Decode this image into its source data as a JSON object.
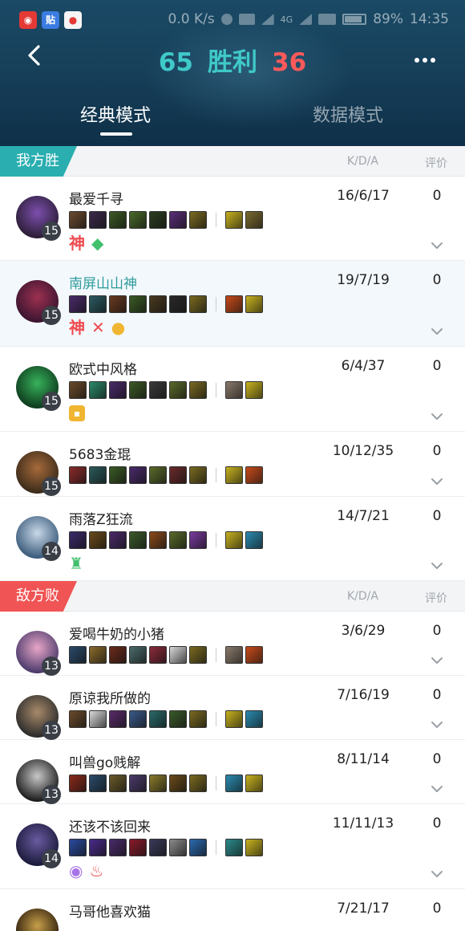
{
  "status_bar": {
    "apps": [
      {
        "name": "netease-music-icon",
        "color": "#e53935"
      },
      {
        "name": "tieba-icon",
        "color": "#3a7ce1"
      },
      {
        "name": "notify-icon",
        "color": "#f5f5f5"
      }
    ],
    "speed": "0.0 K/s",
    "net": "4G",
    "battery": "89%",
    "time": "14:35"
  },
  "header": {
    "back_icon": "back-icon",
    "score_win": "65",
    "result": "胜利",
    "score_lose": "36",
    "more_icon": "more-icon"
  },
  "tabs": [
    {
      "label": "经典模式",
      "active": true
    },
    {
      "label": "数据模式",
      "active": false
    }
  ],
  "columns": {
    "kda": "K/D/A",
    "rating": "评价"
  },
  "teams": [
    {
      "label": "我方胜",
      "color": "#2aaeb0",
      "players": [
        {
          "name": "最爱千寻",
          "level": "15",
          "kda": "16/6/17",
          "rating": "0",
          "highlight": false,
          "name_color": "default",
          "avatar": [
            "#2b1d35",
            "#7c4fae"
          ],
          "items": [
            "#6b4a2e",
            "#3b2a4a",
            "#3c5a24",
            "#4a6a2a",
            "#2c3d20",
            "#5b2e7a",
            "#7a6a20"
          ],
          "spells": [
            "#c7b21f",
            "#7a6a30"
          ],
          "badges": [
            {
              "text": "神",
              "style": "red"
            },
            {
              "text": "◆",
              "style": "green"
            }
          ]
        },
        {
          "name": "南屏山山神",
          "level": "15",
          "kda": "19/7/19",
          "rating": "0",
          "highlight": true,
          "name_color": "teal",
          "avatar": [
            "#3a1530",
            "#9c3050"
          ],
          "items": [
            "#4a2a6a",
            "#2a5a60",
            "#6a3a20",
            "#3a5a24",
            "#4a3a20",
            "#2a2a2a",
            "#7a6a20"
          ],
          "spells": [
            "#c64a1a",
            "#c7b21f"
          ],
          "badges": [
            {
              "text": "神",
              "style": "red"
            },
            {
              "text": "✕",
              "style": "red"
            },
            {
              "text": "●",
              "style": "gold"
            }
          ]
        },
        {
          "name": "欧式中风格",
          "level": "15",
          "kda": "6/4/37",
          "rating": "0",
          "highlight": false,
          "name_color": "default",
          "avatar": [
            "#0e3a1e",
            "#37b25a"
          ],
          "items": [
            "#6a4a2a",
            "#2a8a6a",
            "#4a2a6a",
            "#3a5a24",
            "#3a3a3a",
            "#5a6a2a",
            "#7a6a20"
          ],
          "spells": [
            "#8a7a6a",
            "#c7b21f"
          ],
          "badges": [
            {
              "text": "▪",
              "style": "gold-sq"
            }
          ]
        },
        {
          "name": "5683金琨",
          "level": "15",
          "kda": "10/12/35",
          "rating": "0",
          "highlight": false,
          "name_color": "default",
          "avatar": [
            "#3a2a1a",
            "#a66a3a"
          ],
          "items": [
            "#8a2a2a",
            "#2a5a5a",
            "#3a5a24",
            "#4a2a6a",
            "#5a6a2a",
            "#6a2a2a",
            "#7a6a20"
          ],
          "spells": [
            "#c7b21f",
            "#c64a1a"
          ],
          "badges": []
        },
        {
          "name": "雨落Z狂流",
          "level": "14",
          "kda": "14/7/21",
          "rating": "0",
          "highlight": false,
          "name_color": "default",
          "avatar": [
            "#3a5a7a",
            "#c8d8e8"
          ],
          "items": [
            "#3a2a6a",
            "#6a4a1a",
            "#4a2a6a",
            "#3a5a2a",
            "#8a4a1a",
            "#5a6a2a",
            "#7a3aa0"
          ],
          "spells": [
            "#c7b21f",
            "#2a8ab0"
          ],
          "badges": [
            {
              "text": "♜",
              "style": "green"
            }
          ]
        }
      ]
    },
    {
      "label": "敌方败",
      "color": "#f05454",
      "players": [
        {
          "name": "爱喝牛奶的小猪",
          "level": "13",
          "kda": "3/6/29",
          "rating": "0",
          "highlight": false,
          "name_color": "default",
          "avatar": [
            "#4a3a6a",
            "#e8a6c8"
          ],
          "items": [
            "#2a4a6a",
            "#8a6a2a",
            "#6a2a1a",
            "#4a6a6a",
            "#8a2a3a",
            "#d8d8d8",
            "#7a6a20"
          ],
          "spells": [
            "#8a7a6a",
            "#c64a1a"
          ],
          "badges": []
        },
        {
          "name": "原谅我所做的",
          "level": "13",
          "kda": "7/16/19",
          "rating": "0",
          "highlight": false,
          "name_color": "default",
          "avatar": [
            "#2a2a2a",
            "#a88a6a"
          ],
          "items": [
            "#6a4a2a",
            "#d8d8d8",
            "#5a2a6a",
            "#3a5a8a",
            "#2a6a6a",
            "#3a5a2a",
            "#7a6a20"
          ],
          "spells": [
            "#c7b21f",
            "#2a8ab0"
          ],
          "badges": []
        },
        {
          "name": "叫兽go贱解",
          "level": "13",
          "kda": "8/11/14",
          "rating": "0",
          "highlight": false,
          "name_color": "default",
          "avatar": [
            "#1a1a1a",
            "#c8c8c8"
          ],
          "items": [
            "#8a2a1a",
            "#2a4a6a",
            "#6a5a2a",
            "#4a3a6a",
            "#8a7a2a",
            "#6a4a1a",
            "#7a6a20"
          ],
          "spells": [
            "#2a8ab0",
            "#c7b21f"
          ],
          "badges": []
        },
        {
          "name": "还该不该回来",
          "level": "14",
          "kda": "11/11/13",
          "rating": "0",
          "highlight": false,
          "name_color": "default",
          "avatar": [
            "#1a1a3a",
            "#6a5aa0"
          ],
          "items": [
            "#2a4aa0",
            "#4a2a8a",
            "#4a2a6a",
            "#8a1a2a",
            "#3a3a5a",
            "#8a8a8a",
            "#2a6ab0"
          ],
          "spells": [
            "#2a8a8a",
            "#c7b21f"
          ],
          "badges": [
            {
              "text": "◉",
              "style": "purple"
            },
            {
              "text": "♨",
              "style": "red"
            }
          ]
        },
        {
          "name": "马哥他喜欢猫",
          "level": "",
          "kda": "7/21/17",
          "rating": "0",
          "highlight": false,
          "name_color": "default",
          "avatar": [
            "#2a1a0a",
            "#c8a04a"
          ],
          "items": [],
          "spells": [],
          "badges": []
        }
      ]
    }
  ]
}
